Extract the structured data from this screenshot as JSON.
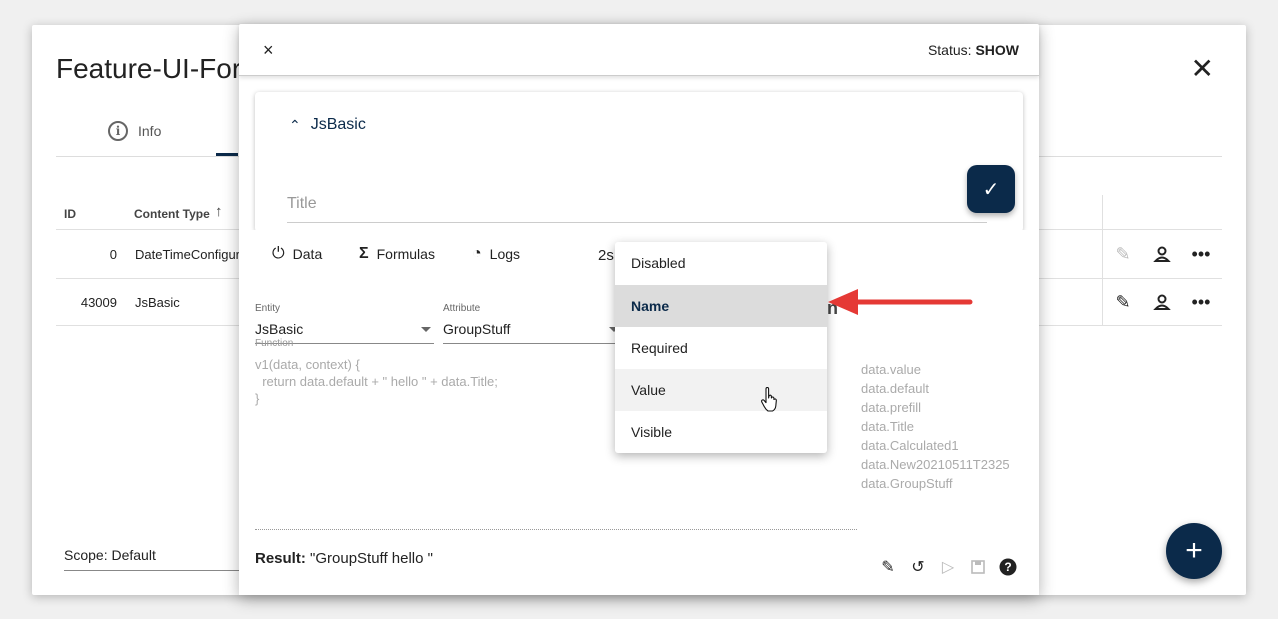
{
  "back": {
    "title": "Feature-UI-For",
    "tabs": [
      {
        "label": "Info",
        "icon": "info-circle-icon"
      }
    ],
    "table": {
      "headers": {
        "id": "ID",
        "content_type": "Content Type"
      },
      "rows": [
        {
          "id": "0",
          "content_type": "DateTimeConfigur"
        },
        {
          "id": "43009",
          "content_type": "JsBasic"
        }
      ]
    },
    "scope": "Scope: Default",
    "add_icon": "+"
  },
  "dialog": {
    "close_icon": "×",
    "status_label": "Status:",
    "status_value": "SHOW",
    "section_title": "JsBasic",
    "title_field_label": "Title",
    "save_icon": "✓"
  },
  "formula": {
    "tabs": [
      {
        "label": "Data",
        "icon": "gauge-icon"
      },
      {
        "label": "Formulas",
        "icon": "sigma-icon"
      },
      {
        "label": "Logs",
        "icon": "speedometer-icon"
      }
    ],
    "tab_partial": "2s",
    "entity_label": "Entity",
    "entity_value": "JsBasic",
    "attribute_label": "Attribute",
    "attribute_value": "GroupStuff",
    "function_label": "Function",
    "function_code": "v1(data, context) {\n  return data.default + \" hello \" + data.Title;\n}",
    "hints": [
      "data.value",
      "data.default",
      "data.prefill",
      "data.Title",
      "data.Calculated1",
      "data.New20210511T2325",
      "data.GroupStuff"
    ],
    "partial_char": "n",
    "result_label": "Result:",
    "result_value": "\"GroupStuff hello \""
  },
  "dropdown": {
    "options": [
      "Disabled",
      "Name",
      "Required",
      "Value",
      "Visible"
    ],
    "selected": "Name",
    "hovered": "Value"
  },
  "colors": {
    "primary": "#0b2a4a",
    "arrow": "#e53935"
  }
}
